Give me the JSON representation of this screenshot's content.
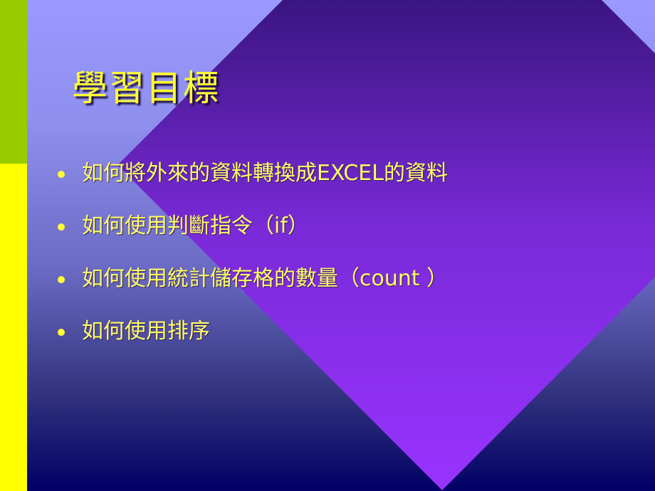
{
  "slide": {
    "title": "學習目標",
    "bullets": [
      {
        "text": "如何將外來的資料轉換成EXCEL的資料"
      },
      {
        "text": "如何使用判斷指令（if）"
      },
      {
        "text": "如何使用統計儲存格的數量（count ）"
      },
      {
        "text": "如何使用排序"
      }
    ]
  },
  "colors": {
    "background_top": "#9999ff",
    "background_bottom": "#000066",
    "diamond_top": "#3a1580",
    "diamond_bottom": "#9933ff",
    "accent_bar_green": "#99cc00",
    "accent_bar_yellow": "#ffff00",
    "text": "#ffff66"
  }
}
